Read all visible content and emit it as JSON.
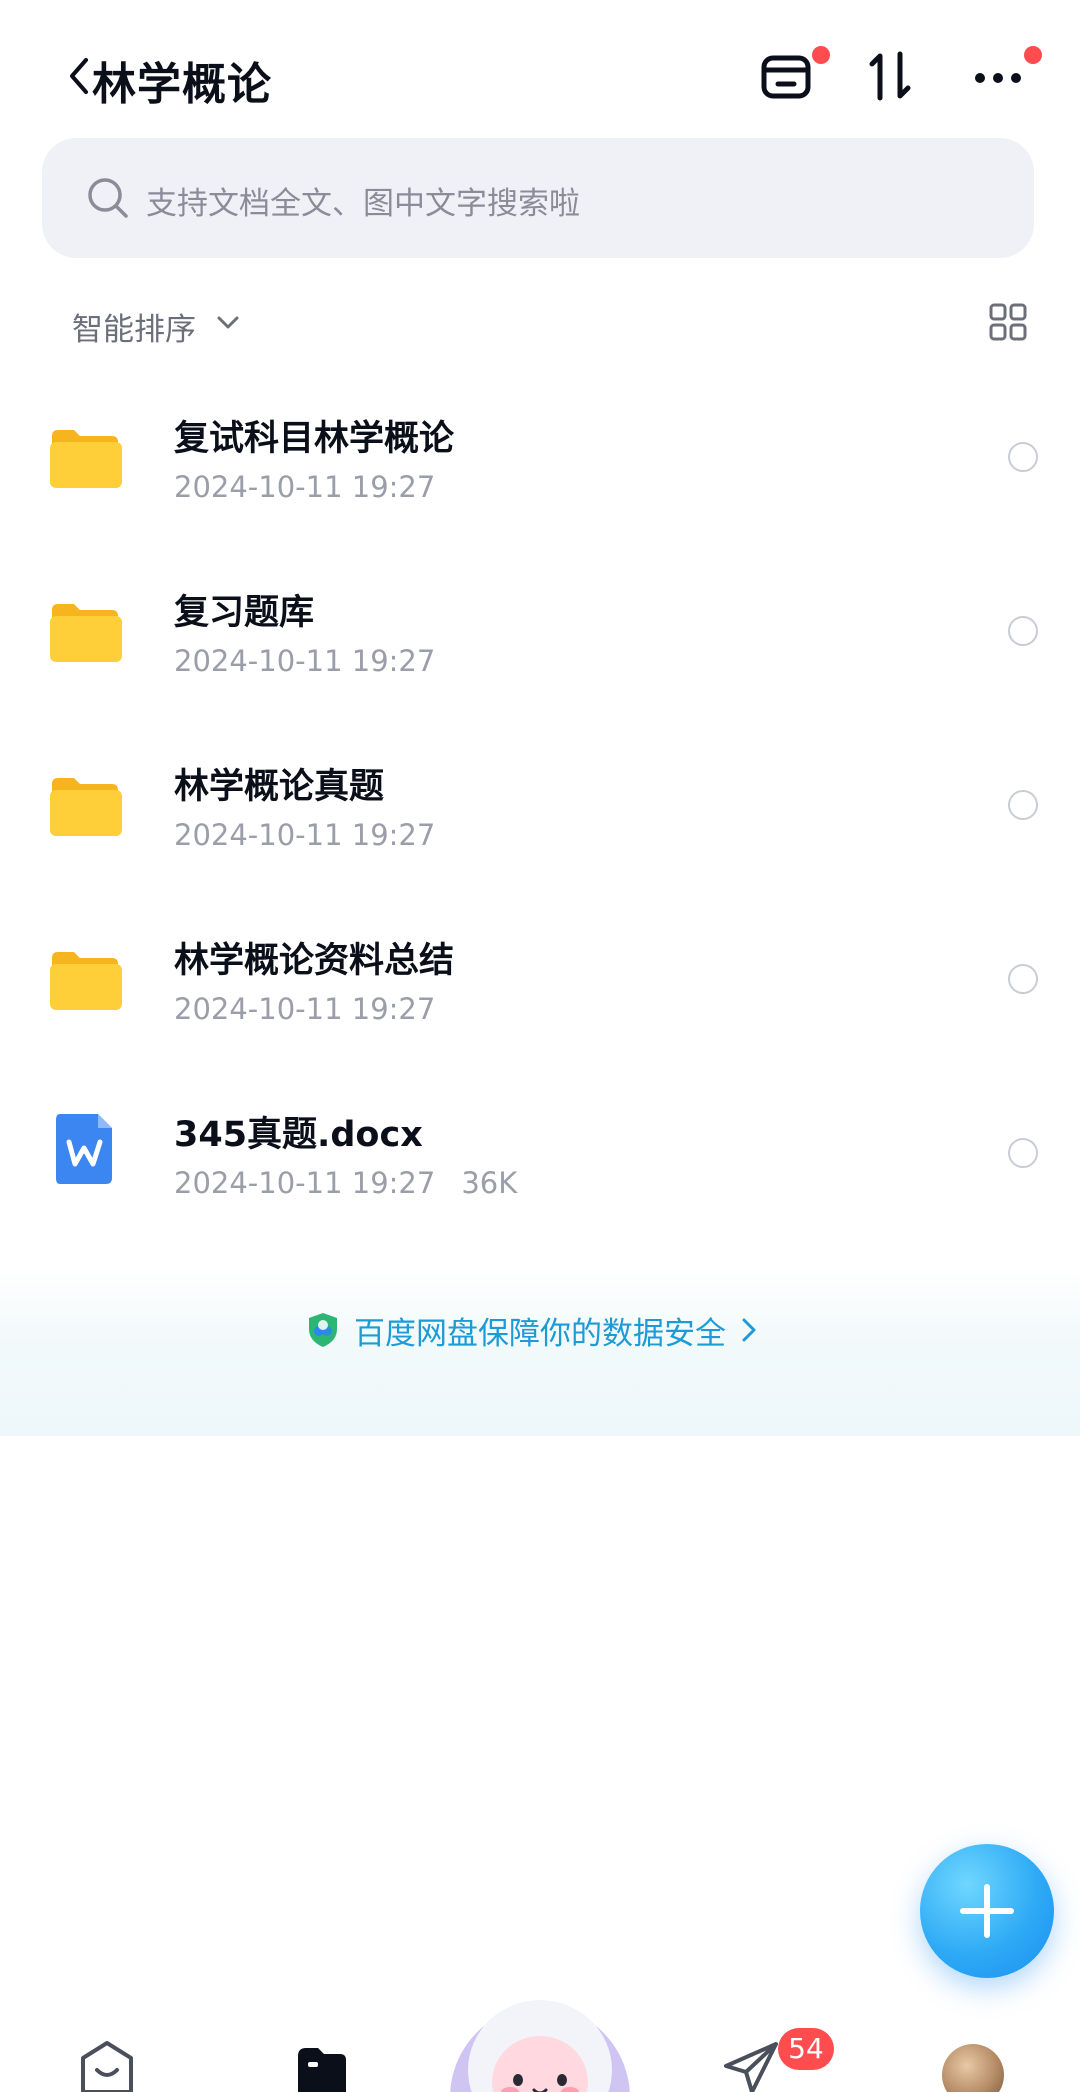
{
  "header": {
    "title": "林学概论",
    "icons": [
      "back-icon",
      "tray-icon",
      "transfer-icon",
      "more-icon"
    ]
  },
  "search": {
    "placeholder": "支持文档全文、图中文字搜索啦"
  },
  "sort": {
    "label": "智能排序"
  },
  "files": [
    {
      "name": "复试科目林学概论",
      "date": "2024-10-11 19:27",
      "size": "",
      "type": "folder"
    },
    {
      "name": "复习题库",
      "date": "2024-10-11 19:27",
      "size": "",
      "type": "folder"
    },
    {
      "name": "林学概论真题",
      "date": "2024-10-11 19:27",
      "size": "",
      "type": "folder"
    },
    {
      "name": "林学概论资料总结",
      "date": "2024-10-11 19:27",
      "size": "",
      "type": "folder"
    },
    {
      "name": "345真题.docx",
      "date": "2024-10-11 19:27",
      "size": "36K",
      "type": "word"
    }
  ],
  "security": {
    "text": "百度网盘保障你的数据安全"
  },
  "tabbar": {
    "badge": "54"
  },
  "colors": {
    "accent": "#1e9bd6",
    "folder": "#ffc935",
    "badge": "#ff4d4f",
    "fab": "#2eaaf5"
  }
}
